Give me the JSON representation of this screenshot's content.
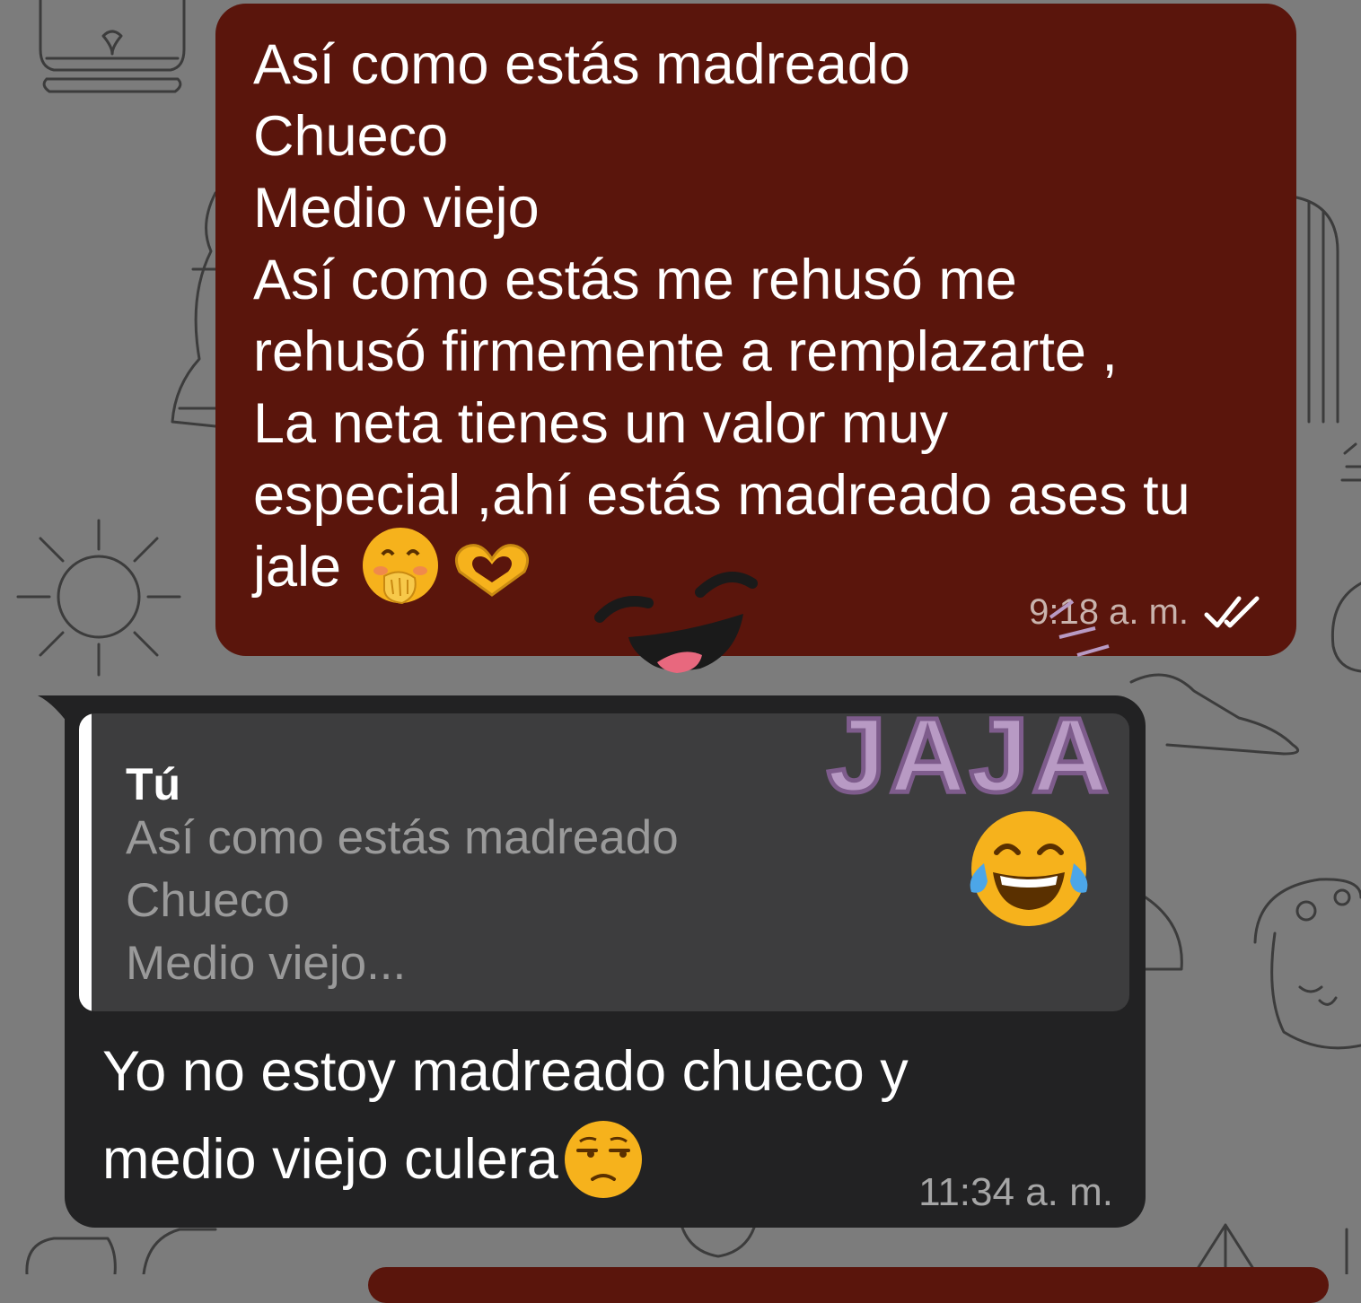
{
  "outgoing": {
    "lines": [
      "Así como estás madreado",
      "Chueco",
      "Medio viejo",
      "Así como estás me rehusó me",
      "rehusó firmemente a remplazarte ,",
      "La neta tienes un valor muy",
      "especial ,ahí estás madreado ases tu"
    ],
    "last_line": "jale",
    "emojis": [
      "hand-over-mouth-emoji",
      "heart-hands-emoji"
    ],
    "time": "9:18 a. m.",
    "status_icon": "double-check-icon"
  },
  "incoming": {
    "quote": {
      "author": "Tú",
      "lines": [
        "Así como estás madreado",
        "Chueco",
        "Medio viejo..."
      ]
    },
    "lines": [
      "Yo no estoy madreado chueco y"
    ],
    "last_line": "medio viejo culera",
    "emoji": "unamused-face-emoji",
    "time": "11:34 a. m."
  },
  "sticker": {
    "text": "JAJA",
    "icons": [
      "laughing-mouth-sticker",
      "tears-of-joy-emoji"
    ]
  },
  "colors": {
    "background": "#7c7c7c",
    "outgoing_bubble": "#5a150c",
    "incoming_bubble": "#222223",
    "quote_box": "#3d3d3e",
    "sticker_text": "#b89ac4"
  }
}
